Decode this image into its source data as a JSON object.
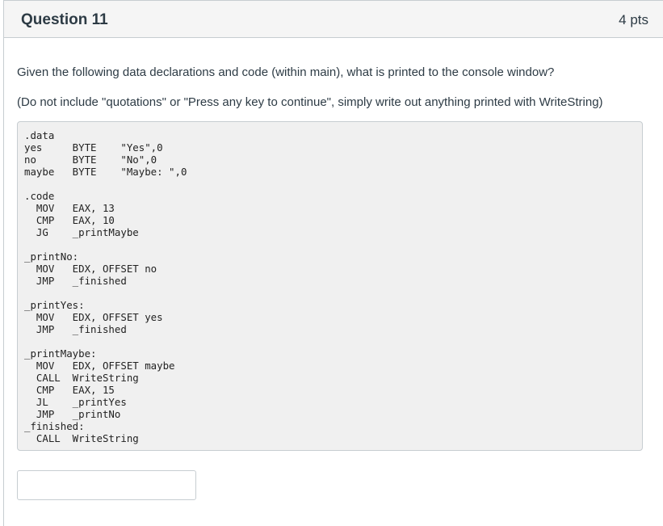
{
  "question": {
    "title": "Question 11",
    "points": "4 pts",
    "prompt": "Given the following data declarations and code (within main), what is printed to the console window?",
    "instruction": "(Do not include \"quotations\" or \"Press any key to continue\", simply write out anything printed with WriteString)"
  },
  "code": {
    "lines": [
      ".data",
      "yes     BYTE    \"Yes\",0",
      "no      BYTE    \"No\",0",
      "maybe   BYTE    \"Maybe: \",0",
      "",
      ".code",
      "  MOV   EAX, 13",
      "  CMP   EAX, 10",
      "  JG    _printMaybe",
      "",
      "_printNo:",
      "  MOV   EDX, OFFSET no",
      "  JMP   _finished",
      "",
      "_printYes:",
      "  MOV   EDX, OFFSET yes",
      "  JMP   _finished",
      "",
      "_printMaybe:",
      "  MOV   EDX, OFFSET maybe",
      "  CALL  WriteString",
      "  CMP   EAX, 15",
      "  JL    _printYes",
      "  JMP   _printNo",
      "_finished:",
      "  CALL  WriteString"
    ]
  },
  "answer": {
    "value": "",
    "placeholder": ""
  }
}
